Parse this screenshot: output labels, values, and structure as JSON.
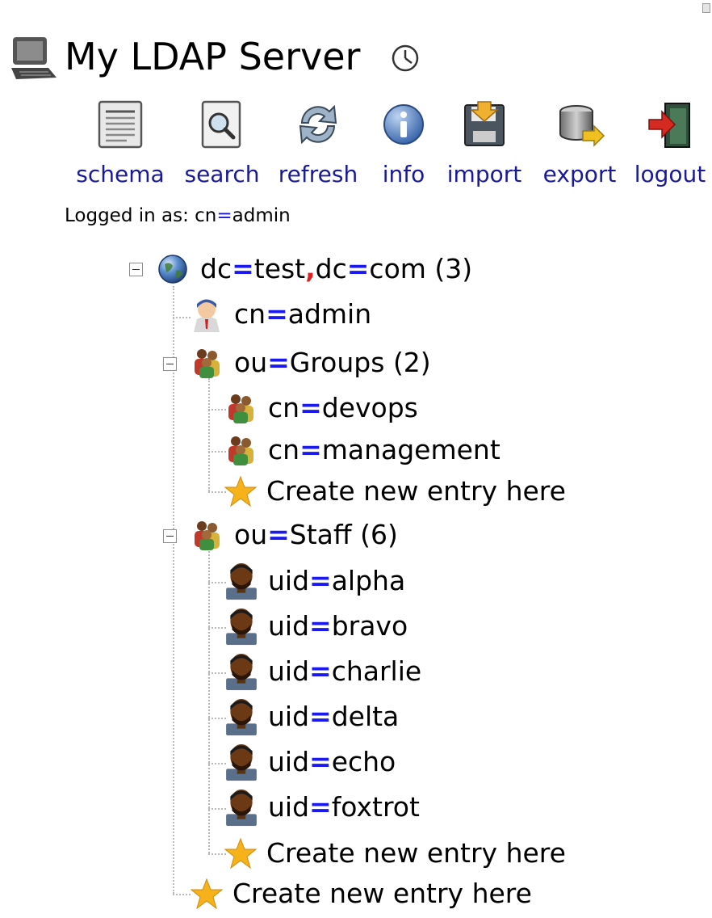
{
  "header": {
    "server_name": "My LDAP Server"
  },
  "toolbar": {
    "items": [
      {
        "label": "schema",
        "icon": "schema-icon"
      },
      {
        "label": "search",
        "icon": "search-icon"
      },
      {
        "label": "refresh",
        "icon": "refresh-icon"
      },
      {
        "label": "info",
        "icon": "info-icon"
      },
      {
        "label": "import",
        "icon": "import-icon"
      },
      {
        "label": "export",
        "icon": "export-icon"
      },
      {
        "label": "logout",
        "icon": "logout-icon"
      }
    ]
  },
  "session": {
    "logged_in_label": "Logged in as: cn",
    "logged_in_value": "admin"
  },
  "tree": {
    "root": {
      "attr": "dc",
      "value": "test",
      "attr2": "dc",
      "value2": "com",
      "count": "(3)",
      "icon": "globe-icon"
    },
    "admin": {
      "attr": "cn",
      "value": "admin",
      "icon": "admin-user-icon"
    },
    "groups": {
      "attr": "ou",
      "value": "Groups",
      "count": "(2)",
      "icon": "group-icon",
      "children": [
        {
          "attr": "cn",
          "value": "devops",
          "icon": "group-icon"
        },
        {
          "attr": "cn",
          "value": "management",
          "icon": "group-icon"
        }
      ],
      "create_label": "Create new entry here"
    },
    "staff": {
      "attr": "ou",
      "value": "Staff",
      "count": "(6)",
      "icon": "group-icon",
      "children": [
        {
          "attr": "uid",
          "value": "alpha",
          "icon": "person-icon"
        },
        {
          "attr": "uid",
          "value": "bravo",
          "icon": "person-icon"
        },
        {
          "attr": "uid",
          "value": "charlie",
          "icon": "person-icon"
        },
        {
          "attr": "uid",
          "value": "delta",
          "icon": "person-icon"
        },
        {
          "attr": "uid",
          "value": "echo",
          "icon": "person-icon"
        },
        {
          "attr": "uid",
          "value": "foxtrot",
          "icon": "person-icon"
        }
      ],
      "create_label": "Create new entry here"
    },
    "root_create_label": "Create new entry here"
  },
  "colors": {
    "link": "#1a1a99",
    "equals": "#1a1aee",
    "comma": "#e02020",
    "star": "#f5b21a"
  }
}
